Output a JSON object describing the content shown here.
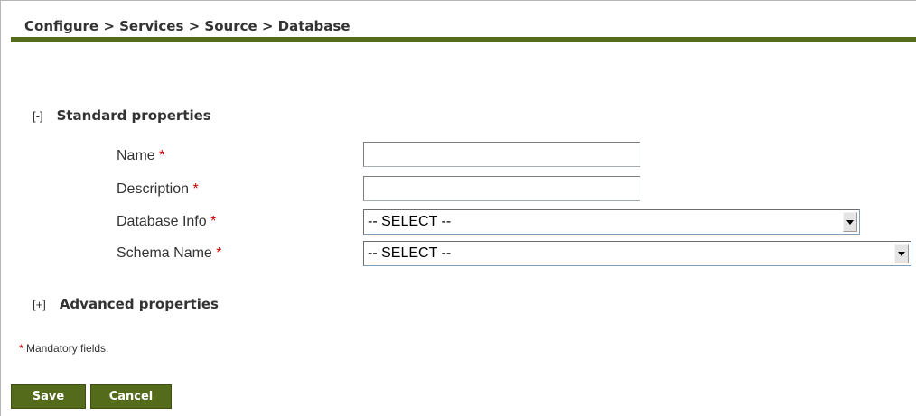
{
  "breadcrumb": "Configure > Services > Source > Database",
  "standard_section": {
    "toggle": "[-]",
    "title": "Standard properties"
  },
  "advanced_section": {
    "toggle": "[+]",
    "title": "Advanced properties"
  },
  "fields": {
    "name": {
      "label": "Name",
      "required_marker": "*",
      "value": ""
    },
    "description": {
      "label": "Description",
      "required_marker": "*",
      "value": ""
    },
    "database_info": {
      "label": "Database Info",
      "required_marker": "*",
      "selected": "-- SELECT --"
    },
    "schema_name": {
      "label": "Schema Name",
      "required_marker": "*",
      "selected": "-- SELECT --"
    }
  },
  "mandatory_note": {
    "marker": "*",
    "text": "Mandatory fields."
  },
  "buttons": {
    "save": "Save",
    "cancel": "Cancel"
  },
  "colors": {
    "accent": "#556b1c",
    "required": "#cc0000",
    "text": "#333333"
  }
}
